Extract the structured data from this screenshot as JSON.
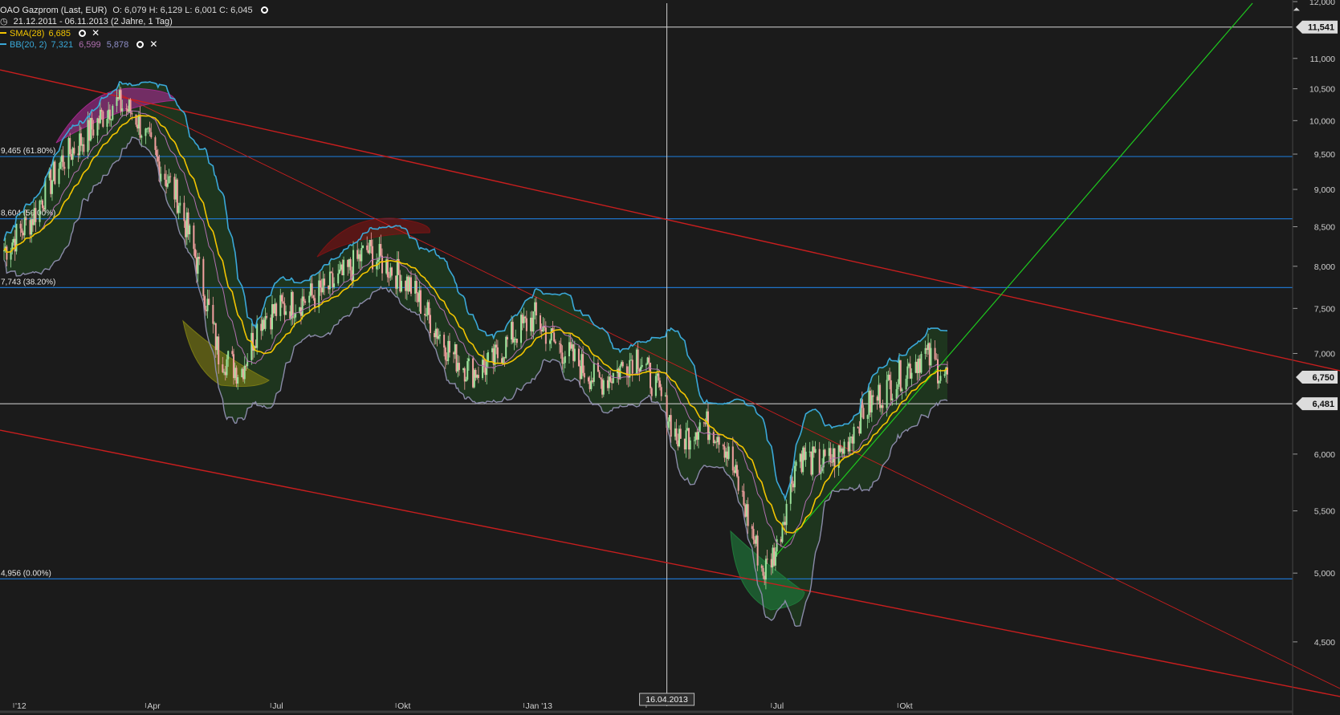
{
  "header": {
    "title": "OAO Gazprom (Last, EUR)",
    "ohlc": "O: 6,079  H: 6,129  L: 6,001  C: 6,045",
    "range": "21.12.2011 - 06.11.2013 (2 Jahre, 1 Tag)",
    "sma_label": "SMA(28)",
    "sma_value": "6,685",
    "bb_label": "BB(20, 2)",
    "bb_upper": "7,321",
    "bb_mid": "6,599",
    "bb_lower": "5,878"
  },
  "colors": {
    "background": "#1b1b1b",
    "candle_up": "#9be39b",
    "candle_down": "#f2a0a0",
    "sma": "#f2c400",
    "bb_band": "#3aa8d8",
    "bb_fill": "#1e3a1e",
    "fib_line": "#1e73c8",
    "trend_red": "#c81e1e",
    "trend_green": "#1ec81e",
    "price_tag_bg": "#e8e8e8"
  },
  "chart_data": {
    "type": "candlestick",
    "title": "OAO Gazprom (Last, EUR)",
    "yscale": "log",
    "ylim": [
      4.2,
      12.0
    ],
    "x_ticks": [
      "'12",
      "Apr",
      "Jul",
      "Okt",
      "Jan '13",
      "Apr",
      "Jul",
      "Okt"
    ],
    "y_ticks": [
      "12,000",
      "11,000",
      "10,500",
      "10,000",
      "9,500",
      "9,000",
      "8,500",
      "8,000",
      "7,500",
      "7,000",
      "6,000",
      "5,500",
      "5,000",
      "4,500"
    ],
    "price_tags": [
      {
        "label": "11,541",
        "value": 11.541
      },
      {
        "label": "6,750",
        "value": 6.75
      },
      {
        "label": "6,481",
        "value": 6.481
      }
    ],
    "fib_levels": [
      {
        "label": "9,465 (61.80%)",
        "value": 9.465
      },
      {
        "label": "8,604 (50.00%)",
        "value": 8.604
      },
      {
        "label": "7,743 (38.20%)",
        "value": 7.743
      },
      {
        "label": "4,956 (0.00%)",
        "value": 4.956
      }
    ],
    "crosshair_date": "16.04.2013",
    "close": [
      {
        "date": "2011-12-21",
        "value": 8.2
      },
      {
        "date": "2012-01-10",
        "value": 8.6
      },
      {
        "date": "2012-02-01",
        "value": 9.4
      },
      {
        "date": "2012-02-20",
        "value": 9.8
      },
      {
        "date": "2012-03-10",
        "value": 10.3
      },
      {
        "date": "2012-03-25",
        "value": 10.1
      },
      {
        "date": "2012-04-10",
        "value": 9.4
      },
      {
        "date": "2012-04-25",
        "value": 8.9
      },
      {
        "date": "2012-05-10",
        "value": 8.0
      },
      {
        "date": "2012-05-25",
        "value": 7.0
      },
      {
        "date": "2012-06-10",
        "value": 6.8
      },
      {
        "date": "2012-06-25",
        "value": 7.4
      },
      {
        "date": "2012-07-10",
        "value": 7.5
      },
      {
        "date": "2012-07-25",
        "value": 7.6
      },
      {
        "date": "2012-08-10",
        "value": 7.7
      },
      {
        "date": "2012-08-25",
        "value": 7.9
      },
      {
        "date": "2012-09-10",
        "value": 8.2
      },
      {
        "date": "2012-09-25",
        "value": 8.0
      },
      {
        "date": "2012-10-10",
        "value": 7.8
      },
      {
        "date": "2012-10-25",
        "value": 7.4
      },
      {
        "date": "2012-11-10",
        "value": 7.0
      },
      {
        "date": "2012-11-25",
        "value": 6.8
      },
      {
        "date": "2012-12-10",
        "value": 6.9
      },
      {
        "date": "2012-12-25",
        "value": 7.2
      },
      {
        "date": "2013-01-10",
        "value": 7.4
      },
      {
        "date": "2013-01-25",
        "value": 7.1
      },
      {
        "date": "2013-02-10",
        "value": 6.9
      },
      {
        "date": "2013-02-25",
        "value": 6.7
      },
      {
        "date": "2013-03-10",
        "value": 6.8
      },
      {
        "date": "2013-03-25",
        "value": 7.0
      },
      {
        "date": "2013-04-10",
        "value": 6.6
      },
      {
        "date": "2013-04-25",
        "value": 6.1
      },
      {
        "date": "2013-05-10",
        "value": 6.3
      },
      {
        "date": "2013-05-25",
        "value": 6.2
      },
      {
        "date": "2013-06-10",
        "value": 5.6
      },
      {
        "date": "2013-06-25",
        "value": 5.0
      },
      {
        "date": "2013-07-05",
        "value": 5.2
      },
      {
        "date": "2013-07-20",
        "value": 6.0
      },
      {
        "date": "2013-08-05",
        "value": 5.9
      },
      {
        "date": "2013-08-20",
        "value": 6.0
      },
      {
        "date": "2013-09-05",
        "value": 6.4
      },
      {
        "date": "2013-09-20",
        "value": 6.6
      },
      {
        "date": "2013-10-05",
        "value": 6.8
      },
      {
        "date": "2013-10-20",
        "value": 7.0
      },
      {
        "date": "2013-11-06",
        "value": 6.75
      }
    ]
  }
}
